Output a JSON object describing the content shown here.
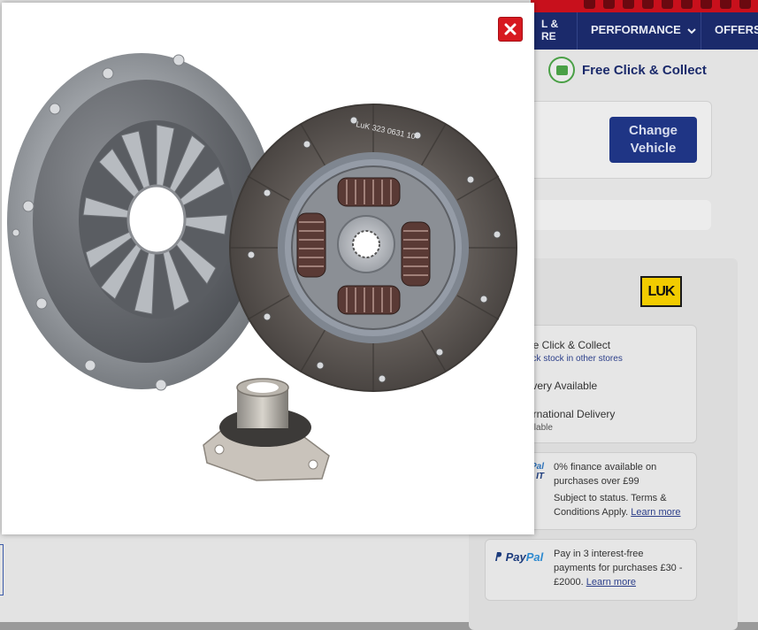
{
  "header": {
    "nav_partial": "L &\nRE",
    "nav_performance": "PERFORMANCE",
    "nav_offers": "OFFERS"
  },
  "click_collect_banner": "Free Click & Collect",
  "vehicle": {
    "change_button": "Change Vehicle"
  },
  "brand": {
    "logo_text": "LUK"
  },
  "delivery_options": {
    "click_collect": "ee Click & Collect",
    "check_stock_link": "eck stock in other stores",
    "delivery": "livery Available",
    "international": "ernational Delivery",
    "international_status": "ailable"
  },
  "finance": {
    "logo_line1": "Pal",
    "logo_line2": "IT",
    "headline": "0% finance available on purchases over £99",
    "terms": "Subject to status. Terms & Conditions Apply.",
    "learn_more": "Learn more"
  },
  "paypal": {
    "logo_pay": "Pay",
    "logo_pal": "Pal",
    "text": "Pay in 3 interest-free payments for purchases £30 - £2000.",
    "learn_more": "Learn more"
  },
  "modal": {
    "image_description": "Clutch kit: pressure plate, clutch disc and release bearing",
    "disc_marking": "LuK 323 0631 10"
  },
  "colors": {
    "brand_red": "#d71920",
    "brand_navy": "#1b2a6b",
    "button_blue": "#1f3585",
    "collect_green": "#4aa046",
    "luk_yellow": "#f2cc00"
  }
}
